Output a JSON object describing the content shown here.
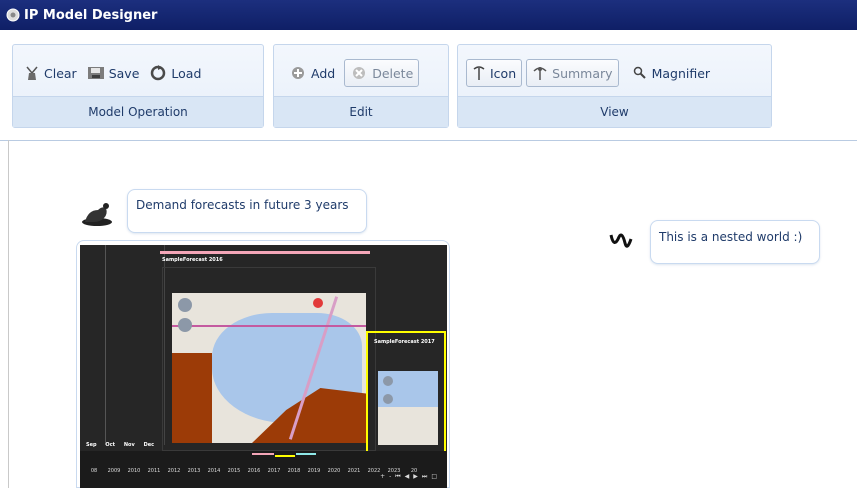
{
  "window": {
    "title": "IP Model Designer"
  },
  "toolbar": {
    "groups": [
      {
        "label": "Model Operation",
        "buttons": [
          {
            "label": "Clear",
            "icon": "broom-icon"
          },
          {
            "label": "Save",
            "icon": "save-icon"
          },
          {
            "label": "Load",
            "icon": "load-icon"
          }
        ]
      },
      {
        "label": "Edit",
        "buttons": [
          {
            "label": "Add",
            "icon": "add-icon"
          },
          {
            "label": "Delete",
            "icon": "delete-icon",
            "disabled": true
          }
        ]
      },
      {
        "label": "View",
        "buttons": [
          {
            "label": "Icon",
            "icon": "tree-icon"
          },
          {
            "label": "Summary",
            "icon": "summary-icon",
            "disabled": true
          },
          {
            "label": "Magnifier",
            "icon": "magnifier-icon"
          }
        ]
      }
    ]
  },
  "canvas": {
    "nodes": [
      {
        "text": "Demand forecasts in future 3 years",
        "icon": "seal-icon"
      },
      {
        "text": "This is a nested world :)",
        "icon": "glyph-icon"
      }
    ],
    "forecast_view": {
      "panel_titles": [
        "SampleForecast 2016",
        "SampleForecast 2017"
      ],
      "months": [
        "Sep",
        "Oct",
        "Nov",
        "Dec"
      ],
      "years": [
        "08",
        "2009",
        "2010",
        "2011",
        "2012",
        "2013",
        "2014",
        "2015",
        "2016",
        "2017",
        "2018",
        "2019",
        "2020",
        "2021",
        "2022",
        "2023",
        "20"
      ],
      "nav_symbols": [
        "+",
        "-",
        "⏮",
        "◀",
        "▶",
        "⏭",
        "□"
      ]
    }
  },
  "colors": {
    "titlebar": "#142470",
    "ribbon_group": "#e7eff9",
    "accent_yellow": "#ffff00",
    "accent_pink": "#f4a6b8",
    "terrain": "#9c3b07"
  }
}
